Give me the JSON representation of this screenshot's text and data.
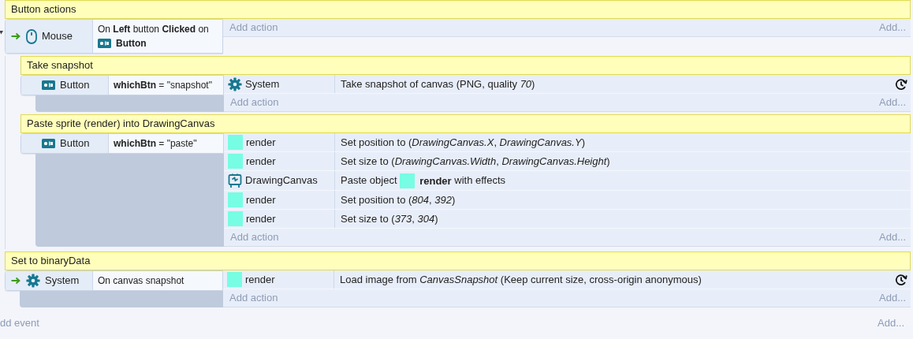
{
  "events": [
    {
      "kind": "comment",
      "text": "Button actions"
    },
    {
      "kind": "event",
      "trigger": true,
      "expanded": true,
      "conditions": [
        {
          "object": "Mouse",
          "kind": "mouse",
          "parts": [
            {
              "kind": "text",
              "text": "On **Left** button **Clicked** on"
            },
            {
              "kind": "button",
              "text": "Button"
            }
          ]
        }
      ],
      "add_action": "Add action",
      "add": "Add...",
      "children": [
        {
          "kind": "comment",
          "text": "Take snapshot"
        },
        {
          "kind": "event",
          "trigger": false,
          "conditions": [
            {
              "object": "Button",
              "kind": "button",
              "parts": [
                {
                  "kind": "text",
                  "text": "**whichBtn** = \"snapshot\""
                }
              ]
            }
          ],
          "actions": [
            {
              "object": "System",
              "kind": "system",
              "async": true,
              "parts": [
                {
                  "kind": "text",
                  "text": "Take snapshot of canvas (PNG, quality *70*)"
                }
              ]
            }
          ],
          "add_action": "Add action",
          "add": "Add..."
        },
        {
          "kind": "comment",
          "text": "Paste sprite (render) into DrawingCanvas"
        },
        {
          "kind": "event",
          "trigger": false,
          "conditions": [
            {
              "object": "Button",
              "kind": "button",
              "parts": [
                {
                  "kind": "text",
                  "text": "**whichBtn** = \"paste\""
                }
              ]
            }
          ],
          "actions": [
            {
              "object": "render",
              "kind": "sprite",
              "async": false,
              "parts": [
                {
                  "kind": "text",
                  "text": "Set position to (*DrawingCanvas.X*, *DrawingCanvas.Y*)"
                }
              ]
            },
            {
              "object": "render",
              "kind": "sprite",
              "async": false,
              "parts": [
                {
                  "kind": "text",
                  "text": "Set size to (*DrawingCanvas.Width*, *DrawingCanvas.Height*)"
                }
              ]
            },
            {
              "object": "DrawingCanvas",
              "kind": "canvas",
              "async": false,
              "parts": [
                {
                  "kind": "text",
                  "text": "Paste object"
                },
                {
                  "kind": "sprite",
                  "text": "render"
                },
                {
                  "kind": "text",
                  "text": "with effects"
                }
              ]
            },
            {
              "object": "render",
              "kind": "sprite",
              "async": false,
              "parts": [
                {
                  "kind": "text",
                  "text": "Set position to (*804*, *392*)"
                }
              ]
            },
            {
              "object": "render",
              "kind": "sprite",
              "async": false,
              "parts": [
                {
                  "kind": "text",
                  "text": "Set size to (*373*, *304*)"
                }
              ]
            }
          ],
          "add_action": "Add action",
          "add": "Add..."
        }
      ]
    },
    {
      "kind": "comment",
      "text": "Set to binaryData"
    },
    {
      "kind": "event",
      "trigger": true,
      "conditions": [
        {
          "object": "System",
          "kind": "system",
          "parts": [
            {
              "kind": "text",
              "text": "On canvas snapshot"
            }
          ]
        }
      ],
      "actions": [
        {
          "object": "render",
          "kind": "sprite",
          "async": true,
          "parts": [
            {
              "kind": "text",
              "text": "Load image from *CanvasSnapshot* (Keep current size, cross-origin anonymous)"
            }
          ]
        }
      ],
      "add_action": "Add action",
      "add": "Add..."
    }
  ],
  "footer": {
    "add_event": "dd event",
    "add": "Add..."
  }
}
